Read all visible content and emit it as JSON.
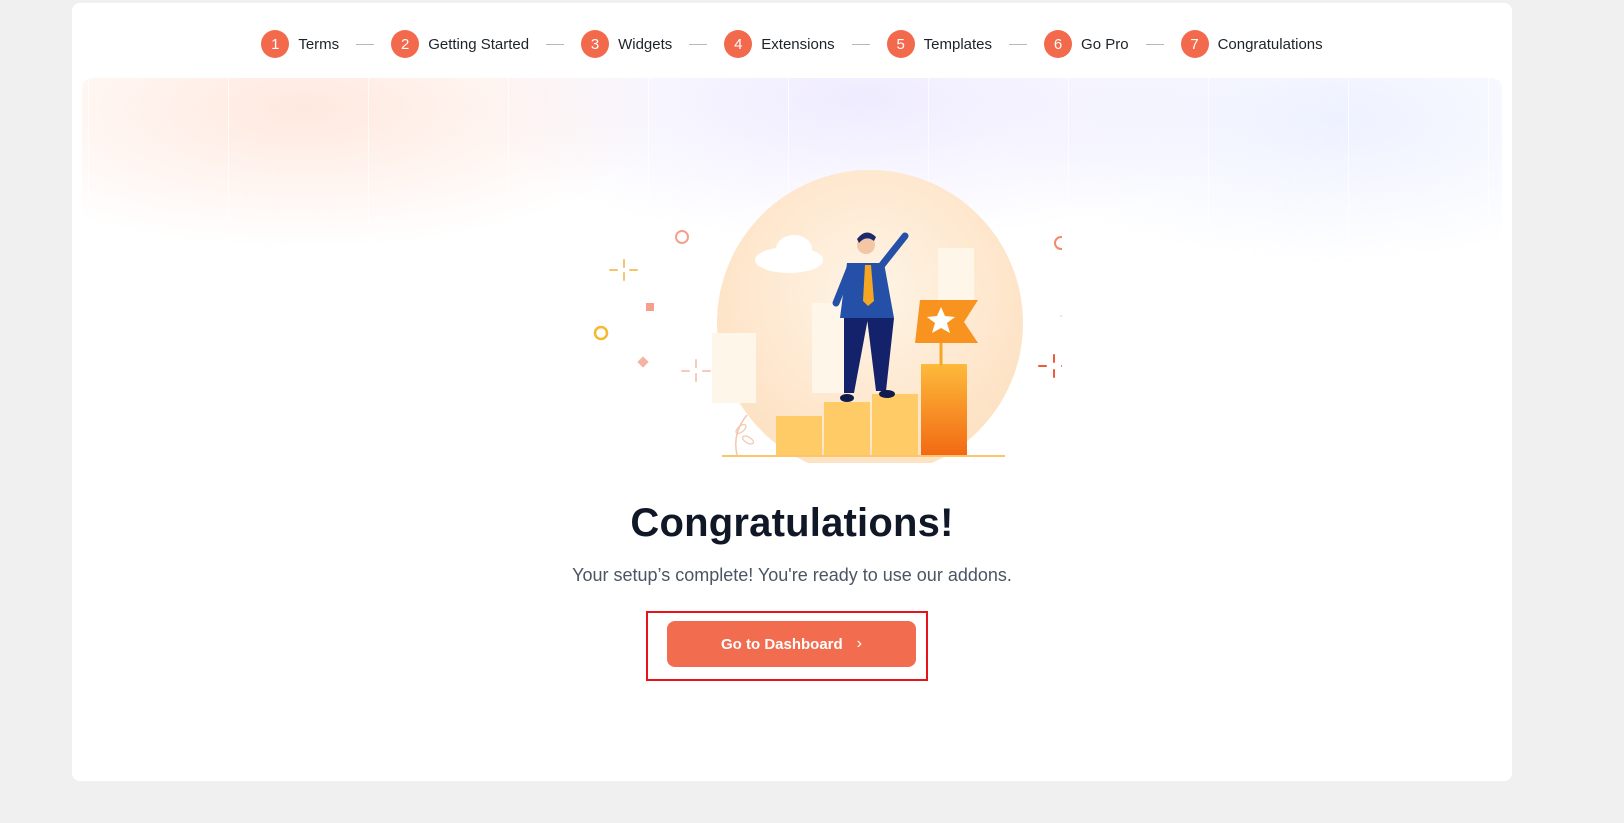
{
  "steps": [
    {
      "num": "1",
      "label": "Terms"
    },
    {
      "num": "2",
      "label": "Getting Started"
    },
    {
      "num": "3",
      "label": "Widgets"
    },
    {
      "num": "4",
      "label": "Extensions"
    },
    {
      "num": "5",
      "label": "Templates"
    },
    {
      "num": "6",
      "label": "Go Pro"
    },
    {
      "num": "7",
      "label": "Congratulations"
    }
  ],
  "main": {
    "title": "Congratulations!",
    "subtitle": "Your setup’s complete! You're ready to use our addons.",
    "cta_label": "Go to Dashboard",
    "cta_icon": "chevron-right-icon"
  },
  "colors": {
    "accent": "#f26c4f",
    "highlight_border": "#e8121b",
    "page_bg": "#f0f0f1"
  }
}
